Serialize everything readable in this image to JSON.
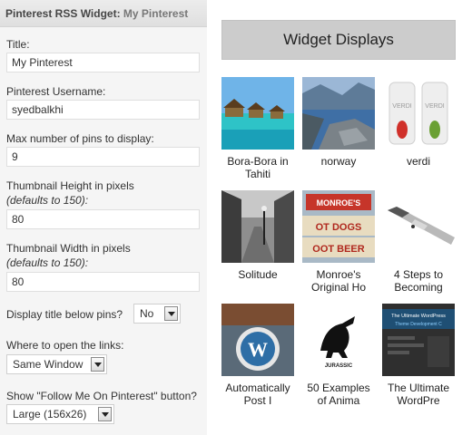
{
  "panel": {
    "title": "Pinterest RSS Widget:",
    "subtitle": "My Pinterest",
    "fields": {
      "title_label": "Title:",
      "title_value": "My Pinterest",
      "username_label": "Pinterest Username:",
      "username_value": "syedbalkhi",
      "max_pins_label": "Max number of pins to display:",
      "max_pins_value": "9",
      "height_label": "Thumbnail Height in pixels",
      "height_hint": "(defaults to 150):",
      "height_value": "80",
      "width_label": "Thumbnail Width in pixels",
      "width_hint": "(defaults to 150):",
      "width_value": "80",
      "display_title_label": "Display title below pins?",
      "display_title_value": "No",
      "open_links_label": "Where to open the links:",
      "open_links_value": "Same Window",
      "follow_button_label": "Show \"Follow Me On Pinterest\" button?",
      "follow_button_value": "Large (156x26)"
    }
  },
  "widget": {
    "header": "Widget Displays",
    "pins": [
      {
        "line1": "Bora-Bora in",
        "line2": "Tahiti"
      },
      {
        "line1": "norway",
        "line2": ""
      },
      {
        "line1": "verdi",
        "line2": ""
      },
      {
        "line1": "Solitude",
        "line2": ""
      },
      {
        "line1": "Monroe's",
        "line2": "Original Ho"
      },
      {
        "line1": "4 Steps to",
        "line2": "Becoming"
      },
      {
        "line1": "Automatically",
        "line2": "Post I"
      },
      {
        "line1": "50 Examples",
        "line2": "of Anima"
      },
      {
        "line1": "The Ultimate",
        "line2": "WordPre"
      }
    ],
    "thumb_text": {
      "verdi_a": "VERDI",
      "verdi_b": "VERDI",
      "monroe_sign": "MONROE'S",
      "hot_dogs": "OT DOGS",
      "root_beer": "OOT BEER",
      "jurassic": "JURASSIC",
      "wp_title": "The Ultimate WordPress",
      "wp_sub": "Theme Development C"
    }
  }
}
